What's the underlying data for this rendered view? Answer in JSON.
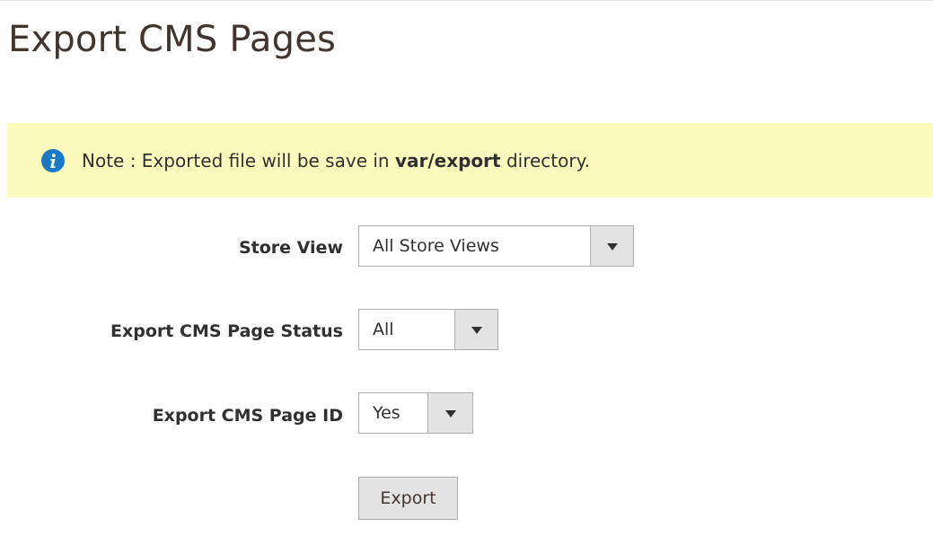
{
  "page": {
    "title": "Export CMS Pages"
  },
  "note": {
    "prefix": "Note : Exported file will be save in ",
    "path": "var/export",
    "suffix": " directory.",
    "icon": "info-icon",
    "icon_color": "#1979c3",
    "background": "#fdfabd"
  },
  "form": {
    "store_view": {
      "label": "Store View",
      "value": "All Store Views"
    },
    "page_status": {
      "label": "Export CMS Page Status",
      "value": "All"
    },
    "page_id": {
      "label": "Export CMS Page ID",
      "value": "Yes"
    },
    "export_button": {
      "label": "Export"
    }
  }
}
